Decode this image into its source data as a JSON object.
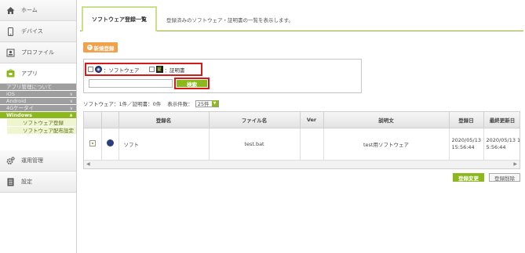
{
  "sidebar": {
    "home": "ホーム",
    "devices": "デバイス",
    "profiles": "プロファイル",
    "apps": "アプリ",
    "app_sections": [
      {
        "label": "アプリ管理について",
        "chevron": ""
      },
      {
        "label": "iOS",
        "chevron": "∨"
      },
      {
        "label": "Android",
        "chevron": "∨"
      },
      {
        "label": "4Gケータイ",
        "chevron": "∨"
      },
      {
        "label": "Windows",
        "chevron": "∧"
      }
    ],
    "windows_items": [
      "ソフトウェア登録",
      "ソフトウェア配布設定"
    ],
    "operations": "運用管理",
    "settings": "設定"
  },
  "header": {
    "tab": "ソフトウェア登録一覧",
    "description": "登録済みのソフトウェア・証明書の一覧を表示します。"
  },
  "toolbar": {
    "new_button": "新規登録"
  },
  "filter": {
    "software_label": "：ソフトウェア",
    "cert_label": "：証明書",
    "cert_icon_text": "証",
    "keyword_value": "",
    "search_button": "検索"
  },
  "summary": {
    "counts": "ソフトウェア：1件／証明書：0件",
    "per_page_label": "表示件数：",
    "per_page_value": "25件"
  },
  "table": {
    "columns": [
      "",
      "",
      "登録名",
      "ファイル名",
      "Ver",
      "説明文",
      "登録日",
      "最終更新日"
    ],
    "rows": [
      {
        "name": "ソフト",
        "file": "test.bat",
        "ver": "",
        "description": "test用ソフトウェア",
        "registered": "2020/05/13 15:56:44",
        "updated": "2020/05/13 15:56:44"
      }
    ]
  },
  "actions": {
    "change": "登録変更",
    "delete": "登録削除"
  },
  "colors": {
    "accent": "#8cb81c",
    "highlight": "#d61a1a",
    "new_button": "#f0a14a"
  }
}
